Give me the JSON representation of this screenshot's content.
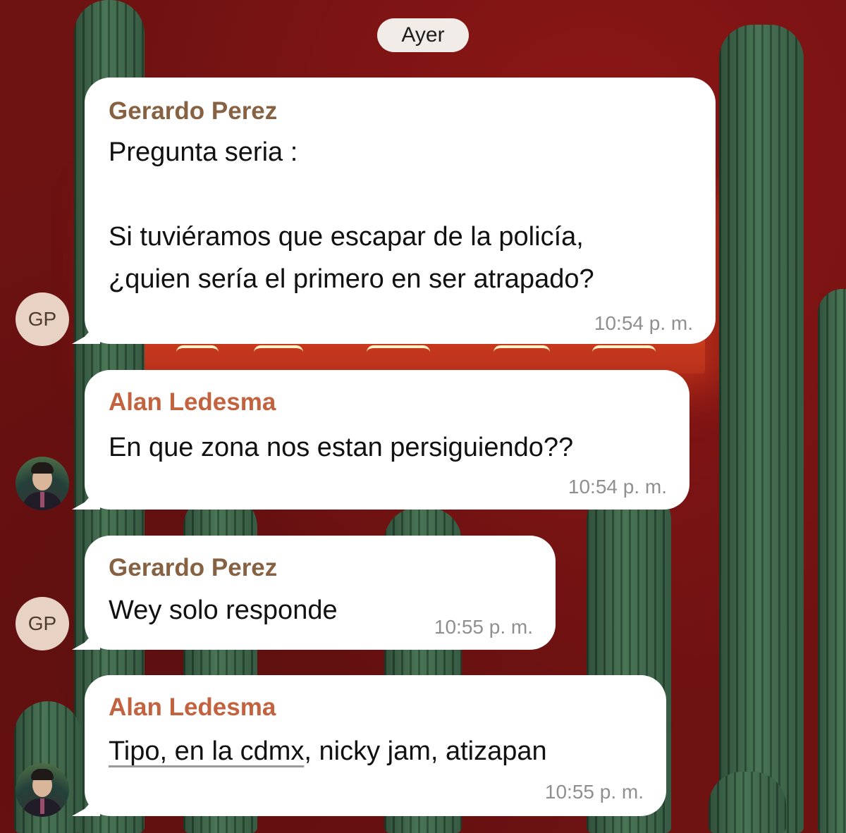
{
  "date_separator": "Ayer",
  "messages": [
    {
      "sender": "Gerardo Perez",
      "lines": [
        "Pregunta seria :",
        "",
        "Si tuviéramos que escapar de la policía,",
        "¿quien sería el primero en ser atrapado?"
      ],
      "time": "10:54 p. m.",
      "avatar_initials": "GP"
    },
    {
      "sender": "Alan Ledesma",
      "lines": [
        "En que zona nos estan persiguiendo??"
      ],
      "time": "10:54 p. m.",
      "avatar": "profile-photo"
    },
    {
      "sender": "Gerardo Perez",
      "lines": [
        "Wey solo responde"
      ],
      "time": "10:55 p. m.",
      "avatar_initials": "GP"
    },
    {
      "sender": "Alan Ledesma",
      "lines": [
        "Tipo, en la cdmx",
        ", nicky jam, atizapan"
      ],
      "time": "10:55 p. m.",
      "avatar": "profile-photo"
    }
  ],
  "colors": {
    "sender_gerardo": "#866142",
    "sender_alan": "#c3623f",
    "bubble": "#ffffff",
    "timestamp": "#8f8f8f",
    "wallpaper": "#6e1212"
  }
}
